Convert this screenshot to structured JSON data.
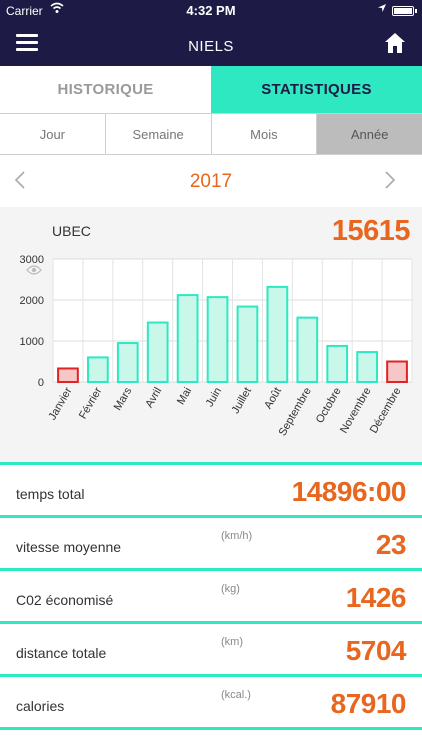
{
  "status": {
    "carrier": "Carrier",
    "time": "4:32 PM"
  },
  "nav": {
    "title": "NIELS"
  },
  "tabs": [
    {
      "label": "HISTORIQUE"
    },
    {
      "label": "STATISTIQUES"
    }
  ],
  "periods": [
    {
      "label": "Jour"
    },
    {
      "label": "Semaine"
    },
    {
      "label": "Mois"
    },
    {
      "label": "Année"
    }
  ],
  "year_nav": {
    "year": "2017"
  },
  "chart_card": {
    "label": "UBEC",
    "total": "15615"
  },
  "chart_data": {
    "type": "bar",
    "categories": [
      "Janvier",
      "Février",
      "Mars",
      "Avril",
      "Mai",
      "Juin",
      "Juillet",
      "Août",
      "Septembre",
      "Octobre",
      "Novembre",
      "Décembre"
    ],
    "values": [
      330,
      600,
      950,
      1450,
      2120,
      2070,
      1840,
      2320,
      1570,
      880,
      730,
      500
    ],
    "ylim": [
      0,
      3000
    ],
    "yticks": [
      0,
      1000,
      2000,
      3000
    ],
    "highlighted": [
      0,
      11
    ],
    "grid": true,
    "colors": {
      "bar_fill": "#c9f7ea",
      "bar_stroke": "#2de8c0",
      "hl_fill": "#f8c6c6",
      "hl_stroke": "#e02424"
    }
  },
  "stats": [
    {
      "name": "temps total",
      "unit": "",
      "value": "14896:00"
    },
    {
      "name": "vitesse moyenne",
      "unit": "(km/h)",
      "value": "23"
    },
    {
      "name": "C02 économisé",
      "unit": "(kg)",
      "value": "1426"
    },
    {
      "name": "distance totale",
      "unit": "(km)",
      "value": "5704"
    },
    {
      "name": "calories",
      "unit": "(kcal.)",
      "value": "87910"
    }
  ],
  "colors": {
    "navy": "#1d1b45",
    "accent": "#2de8c0",
    "orange": "#e8661e"
  }
}
